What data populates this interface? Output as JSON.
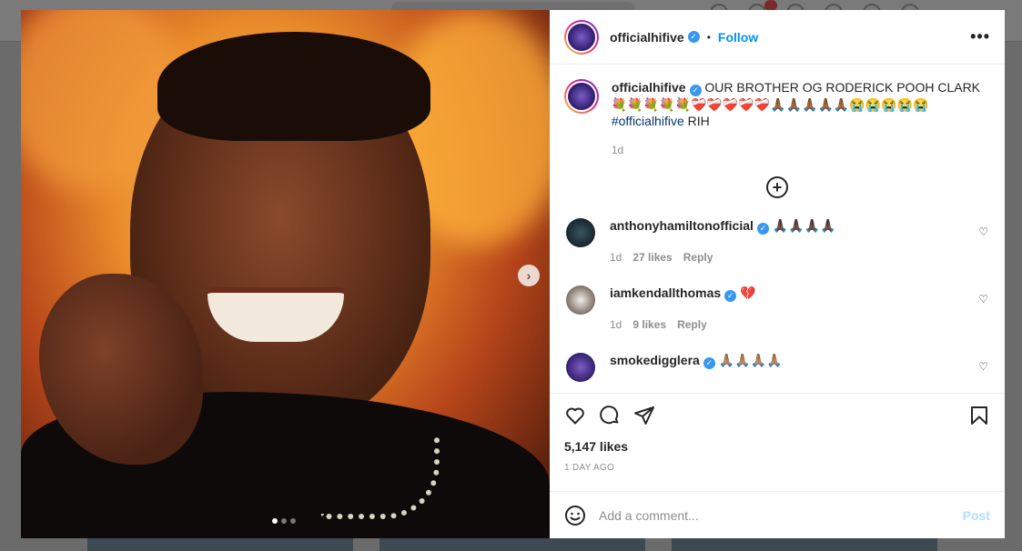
{
  "post": {
    "author": "officialhifive",
    "separator": "•",
    "follow_label": "Follow",
    "more_label": "•••",
    "caption_text": "OUR BROTHER OG RODERICK POOH CLARK 💐💐💐💐💐❤️‍🩹❤️‍🩹❤️‍🩹❤️‍🩹❤️‍🩹🙏🏾🙏🏾🙏🏾🙏🏾🙏🏾😭😭😭😭😭",
    "caption_hashtag": "#officialhifive",
    "caption_suffix": " RIH",
    "caption_age": "1d",
    "image_next_label": "›",
    "likes_text": "5,147 likes",
    "posted_age": "1 DAY AGO"
  },
  "comments": [
    {
      "user": "anthonyhamiltonofficial",
      "text": "🙏🏿🙏🏿🙏🏿🙏🏿",
      "age": "1d",
      "likes": "27 likes",
      "reply": "Reply"
    },
    {
      "user": "iamkendallthomas",
      "text": "💔",
      "age": "1d",
      "likes": "9 likes",
      "reply": "Reply"
    },
    {
      "user": "smokedigglera",
      "text": "🙏🏽🙏🏽🙏🏽🙏🏽",
      "age": "",
      "likes": "",
      "reply": ""
    }
  ],
  "comment_box": {
    "placeholder": "Add a comment...",
    "post_label": "Post"
  },
  "icons": {
    "verified": "verified-badge-icon",
    "like": "heart-icon",
    "comment": "comment-bubble-icon",
    "share": "paper-plane-icon",
    "save": "bookmark-icon",
    "emoji": "smiley-icon",
    "load_more": "plus-circle-icon"
  },
  "colors": {
    "accent": "#0095f6",
    "verified": "#3897f0",
    "hashtag": "#00376b",
    "post_disabled": "#b2dffc"
  }
}
